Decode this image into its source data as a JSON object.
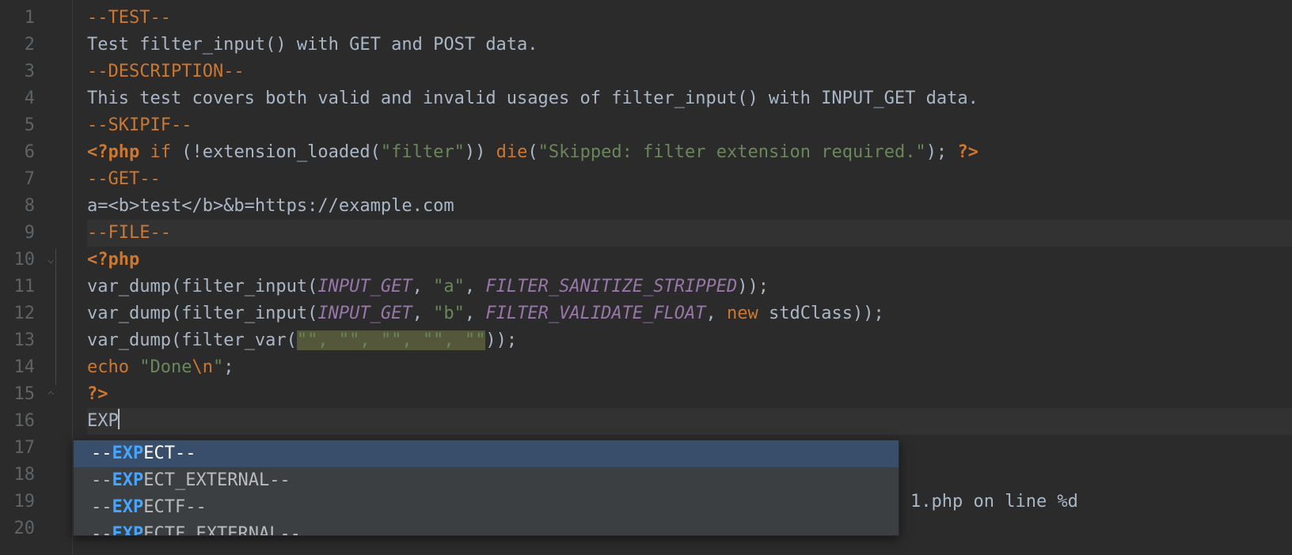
{
  "line_numbers": [
    "1",
    "2",
    "3",
    "4",
    "5",
    "6",
    "7",
    "8",
    "9",
    "10",
    "11",
    "12",
    "13",
    "14",
    "15",
    "16",
    "17",
    "18",
    "19",
    "20"
  ],
  "line1": {
    "test_sect": "--TEST--"
  },
  "line2": {
    "text": "Test filter_input() with GET and POST data."
  },
  "line3": {
    "desc_sect": "--DESCRIPTION--"
  },
  "line4": {
    "text": "This test covers both valid and invalid usages of filter_input() with INPUT_GET data."
  },
  "line5": {
    "skipif_sect": "--SKIPIF--"
  },
  "line6": {
    "php_open": "<?php",
    "if": " if ",
    "cond_open": "(!",
    "fn": "extension_loaded",
    "arg_open": "(",
    "str": "\"filter\"",
    "arg_close": ")) ",
    "die": "die",
    "die_open": "(",
    "die_str": "\"Skipped: filter extension required.\"",
    "die_close": "); ",
    "php_close": "?>"
  },
  "line7": {
    "get_sect": "--GET--"
  },
  "line8": {
    "text": "a=<b>test</b>&b=https://example.com"
  },
  "line9": {
    "file_sect": "--FILE--"
  },
  "line10": {
    "php_open": "<?php"
  },
  "line11": {
    "vd": "var_dump",
    "open": "(",
    "fi": "filter_input",
    "fi_open": "(",
    "ig": "INPUT_GET",
    "c1": ", ",
    "a": "\"a\"",
    "c2": ", ",
    "flt": "FILTER_SANITIZE_STRIPPED",
    "close": "));"
  },
  "line12": {
    "vd": "var_dump",
    "open": "(",
    "fi": "filter_input",
    "fi_open": "(",
    "ig": "INPUT_GET",
    "c1": ", ",
    "b": "\"b\"",
    "c2": ", ",
    "flt": "FILTER_VALIDATE_FLOAT",
    "c3": ", ",
    "new": "new ",
    "std": "stdClass",
    "close": "));"
  },
  "line13": {
    "vd": "var_dump",
    "open": "(",
    "fv": "filter_var",
    "fv_open": "(",
    "args_sel": "\"\", \"\", \"\", \"\", \"\"",
    "close": "));"
  },
  "line14": {
    "echo": "echo ",
    "done": "\"Done",
    "esc": "\\n",
    "done_end": "\"",
    "semi": ";"
  },
  "line15": {
    "php_close": "?>"
  },
  "line16": {
    "typed": "EXP"
  },
  "line19_behind": "1.php on line %d",
  "popup": {
    "items": [
      {
        "pre": "--",
        "match": "EXP",
        "rest": "ECT--"
      },
      {
        "pre": "--",
        "match": "EXP",
        "rest": "ECT_EXTERNAL--"
      },
      {
        "pre": "--",
        "match": "EXP",
        "rest": "ECTF--"
      },
      {
        "pre": "--",
        "match": "EXP",
        "rest": "ECTF_EXTERNAL--"
      }
    ]
  }
}
